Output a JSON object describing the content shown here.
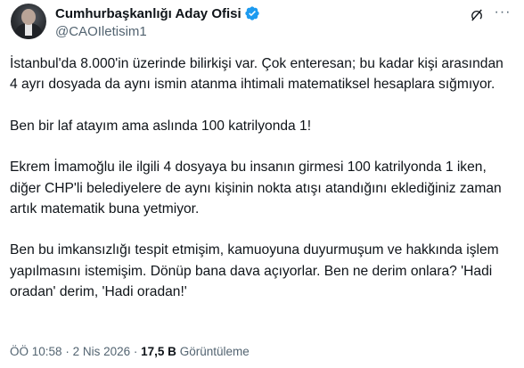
{
  "author": {
    "name": "Cumhurbaşkanlığı Aday Ofisi",
    "handle": "@CAOIletisim1",
    "verified": true,
    "verified_color": "#1d9bf0"
  },
  "icons": {
    "grok": "grok-icon",
    "more": "more-options-icon"
  },
  "tweet": {
    "paragraphs": [
      "İstanbul'da 8.000'in üzerinde bilirkişi var. Çok enteresan; bu kadar kişi arasından 4 ayrı dosyada da aynı ismin atanma ihtimali matematiksel hesaplara sığmıyor.",
      "Ben bir laf atayım ama aslında 100 katrilyonda 1!",
      "Ekrem İmamoğlu ile ilgili 4 dosyaya bu insanın girmesi 100 katrilyonda 1 iken, diğer CHP'li belediyelere de aynı kişinin nokta atışı atandığını eklediğiniz zaman artık matematik buna yetmiyor.",
      "Ben bu imkansızlığı tespit etmişim, kamuoyuna duyurmuşum ve hakkında işlem yapılmasını istemişim. Dönüp bana dava açıyorlar. Ben ne derim onlara? 'Hadi oradan' derim, 'Hadi oradan!'"
    ]
  },
  "meta": {
    "time": "ÖÖ 10:58",
    "separator": "·",
    "date": "2 Nis 2026",
    "views": "17,5 B",
    "views_label": "Görüntüleme"
  }
}
